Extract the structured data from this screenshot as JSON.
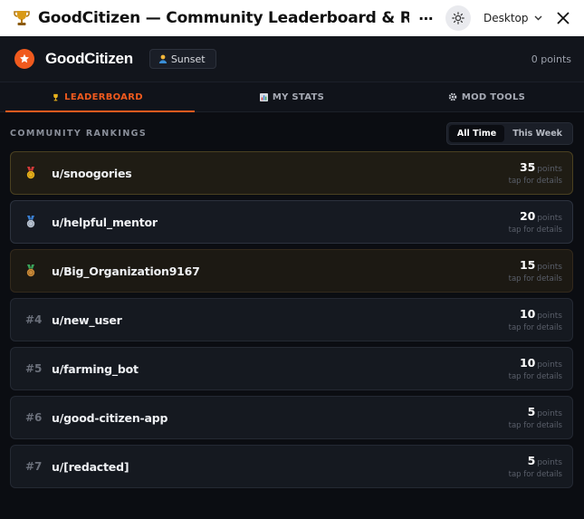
{
  "window": {
    "title": "GoodCitizen — Community Leaderboard & R...",
    "more_label": "⋯",
    "device_label": "Desktop"
  },
  "appbar": {
    "brand": "GoodCitizen",
    "theme_chip": "Sunset",
    "points": "0 points"
  },
  "tabs": [
    {
      "label": "LEADERBOARD",
      "icon": "trophy-icon",
      "active": true
    },
    {
      "label": "MY STATS",
      "icon": "bar-chart-icon",
      "active": false
    },
    {
      "label": "MOD TOOLS",
      "icon": "gear-icon",
      "active": false
    }
  ],
  "rankings": {
    "title": "COMMUNITY RANKINGS",
    "filters": [
      "All Time",
      "This Week"
    ],
    "selected_filter": "All Time",
    "unit_label": "points",
    "hint_label": "tap for details",
    "rows": [
      {
        "rank": "",
        "medal": "gold-medal-icon",
        "user": "u/snoogories",
        "points": "35"
      },
      {
        "rank": "",
        "medal": "silver-medal-icon",
        "user": "u/helpful_mentor",
        "points": "20"
      },
      {
        "rank": "",
        "medal": "bronze-medal-icon",
        "user": "u/Big_Organization9167",
        "points": "15"
      },
      {
        "rank": "#4",
        "medal": "",
        "user": "u/new_user",
        "points": "10"
      },
      {
        "rank": "#5",
        "medal": "",
        "user": "u/farming_bot",
        "points": "10"
      },
      {
        "rank": "#6",
        "medal": "",
        "user": "u/good-citizen-app",
        "points": "5"
      },
      {
        "rank": "#7",
        "medal": "",
        "user": "u/[redacted]",
        "points": "5"
      }
    ]
  },
  "colors": {
    "accent": "#f05a1e",
    "background": "#0b0d12",
    "gold": "#e8b21c",
    "silver": "#b9c3d1",
    "bronze": "#c98a3a"
  }
}
